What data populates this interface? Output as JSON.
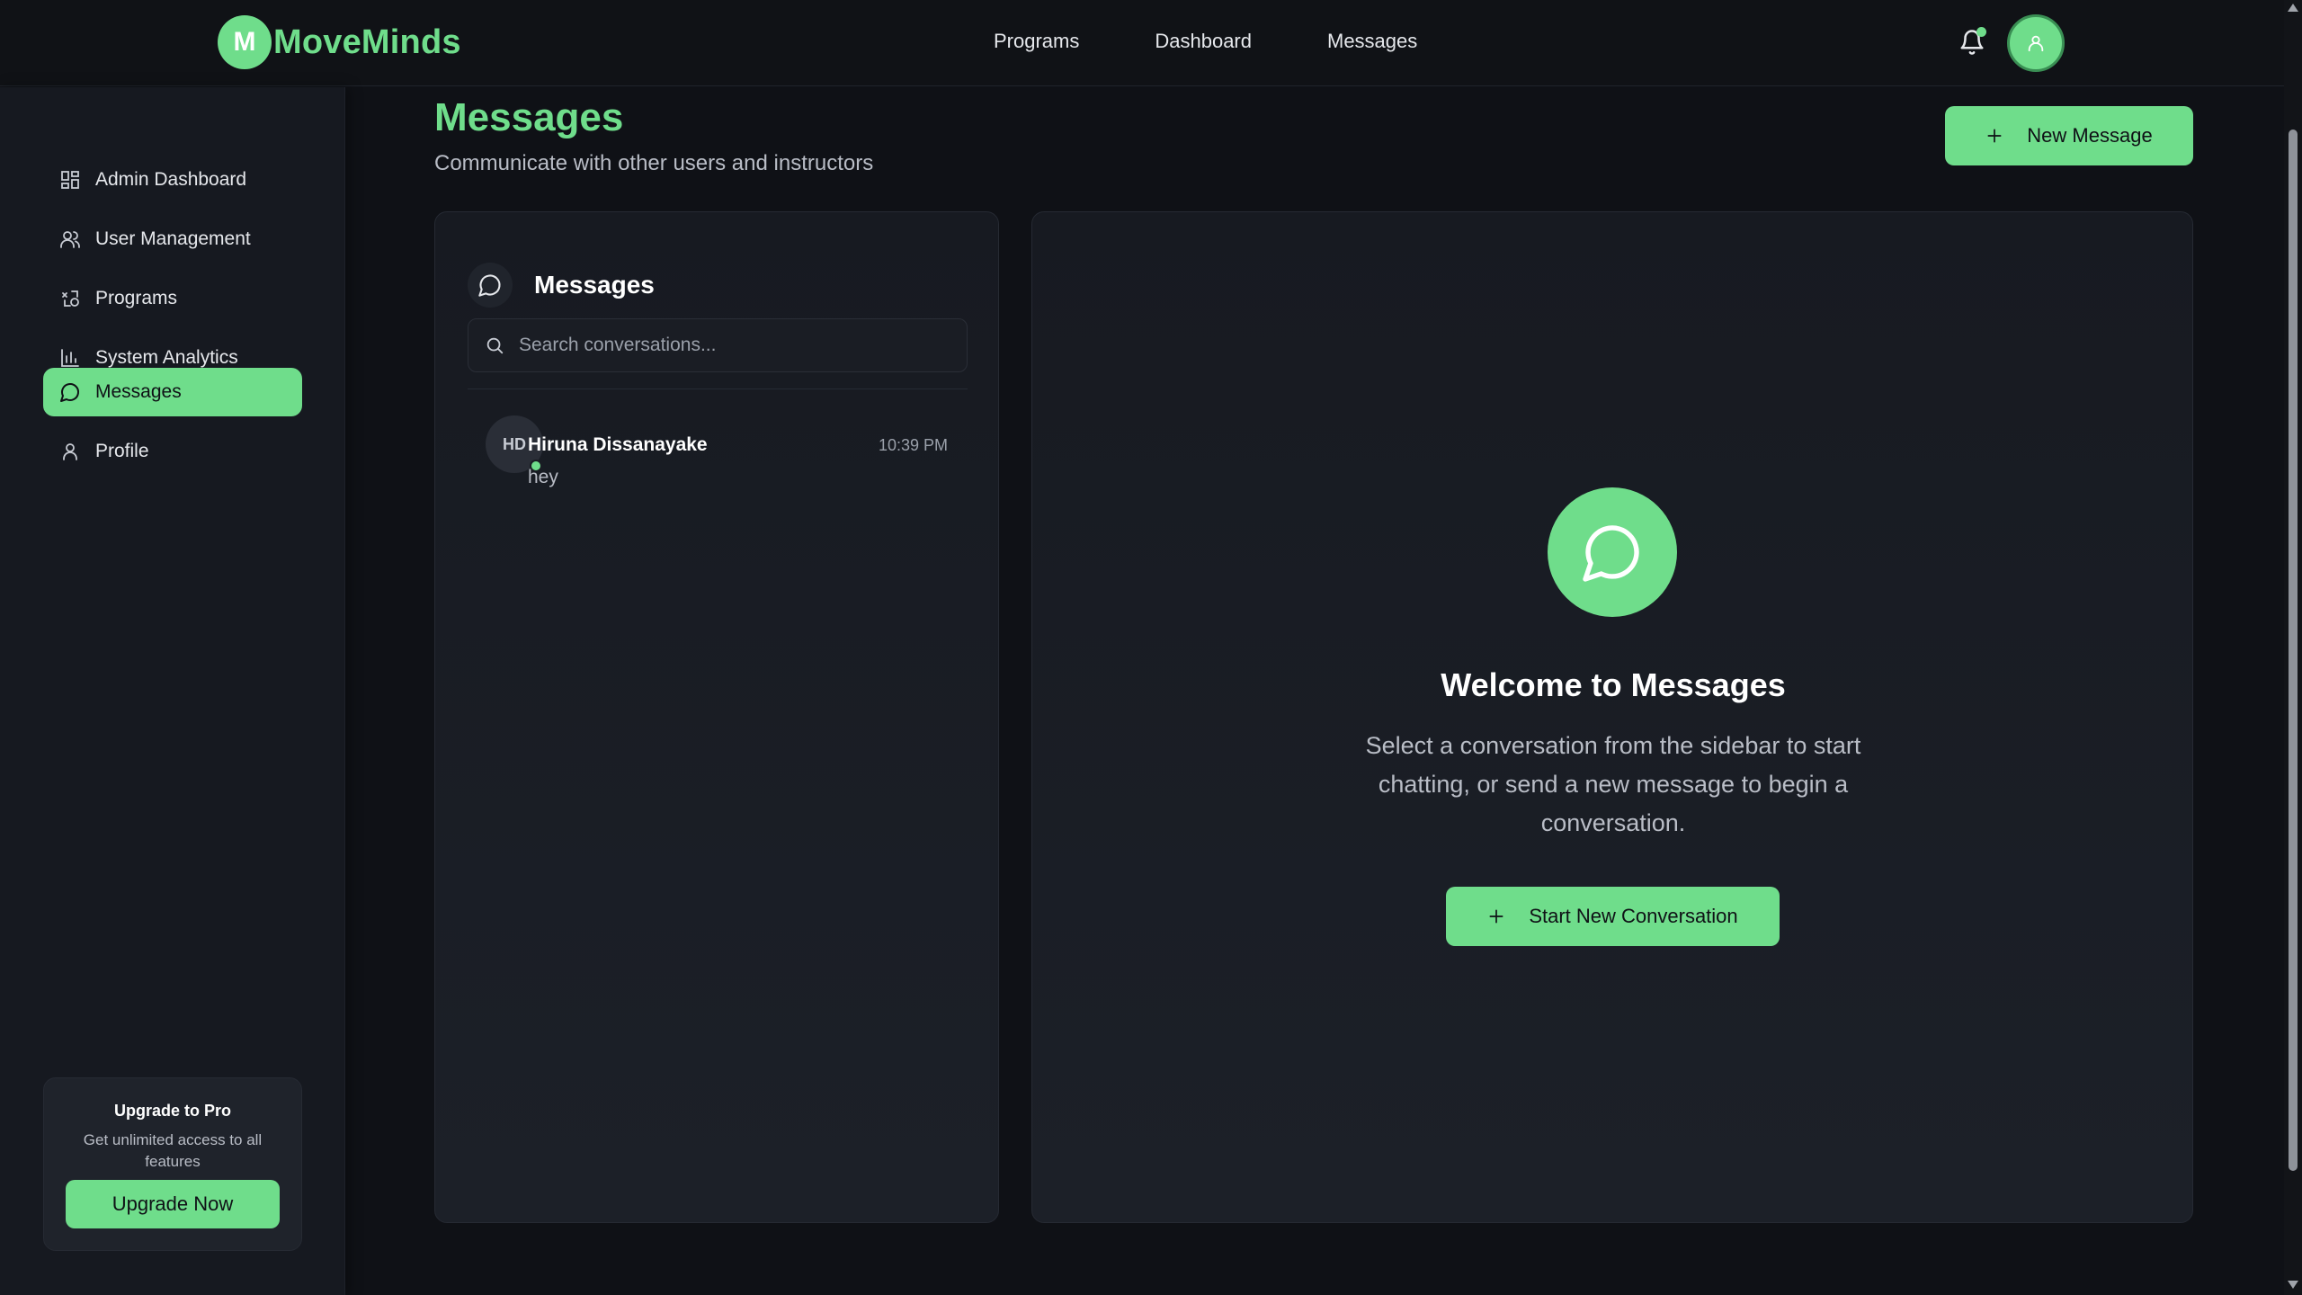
{
  "brand": {
    "mark": "M",
    "name": "MoveMinds"
  },
  "topnav": {
    "items": [
      "Programs",
      "Dashboard",
      "Messages"
    ]
  },
  "sidebar": {
    "items": [
      {
        "label": "Admin Dashboard",
        "icon": "dashboard-icon"
      },
      {
        "label": "User Management",
        "icon": "users-icon"
      },
      {
        "label": "Programs",
        "icon": "programs-icon"
      },
      {
        "label": "System Analytics",
        "icon": "bar-chart-icon"
      },
      {
        "label": "Messages",
        "icon": "message-icon",
        "active": true
      },
      {
        "label": "Profile",
        "icon": "user-icon"
      }
    ],
    "upgrade": {
      "title": "Upgrade to Pro",
      "description": "Get unlimited access to all features",
      "button": "Upgrade Now"
    }
  },
  "page": {
    "title": "Messages",
    "subtitle": "Communicate with other users and instructors",
    "new_message_button": "New Message"
  },
  "conversations": {
    "title": "Messages",
    "search_placeholder": "Search conversations...",
    "items": [
      {
        "initials": "HD",
        "name": "Hiruna Dissanayake",
        "preview": "hey",
        "time": "10:39 PM",
        "online": true
      }
    ]
  },
  "welcome": {
    "title": "Welcome to Messages",
    "text": "Select a conversation from the sidebar to start chatting, or send a new message to begin a conversation.",
    "button": "Start New Conversation"
  },
  "colors": {
    "accent": "#6fdd8b",
    "background": "#0f1116",
    "panel": "#1c2028"
  }
}
